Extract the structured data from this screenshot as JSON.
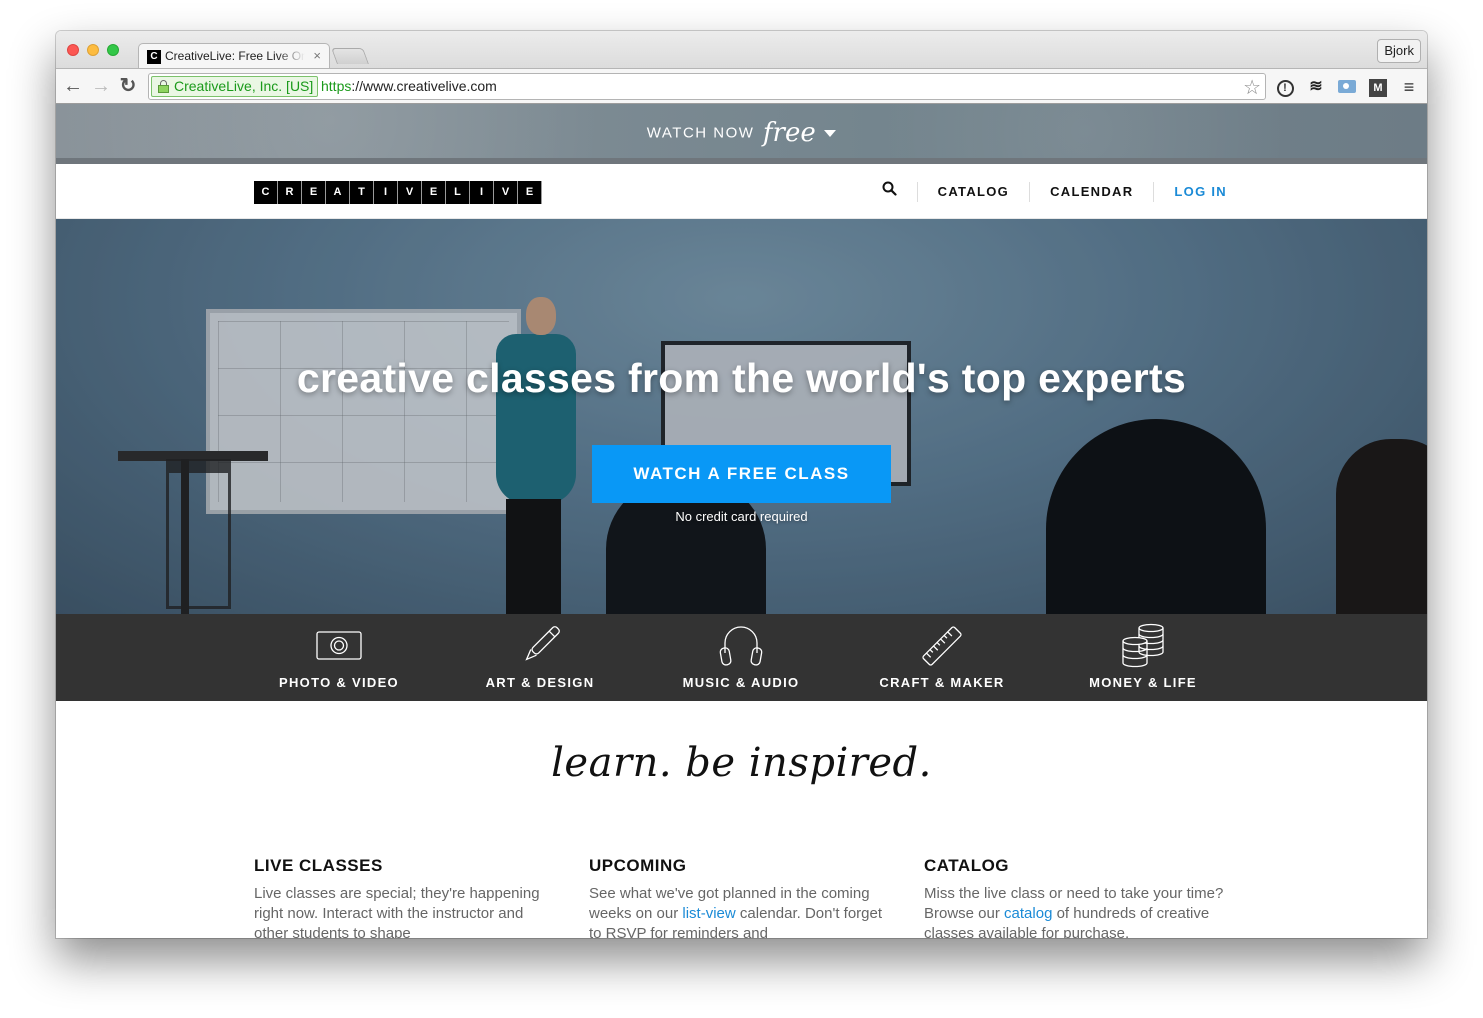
{
  "browser": {
    "tab_favicon": "C",
    "tab_title": "CreativeLive: Free Live Online",
    "tab_close": "×",
    "profile_name": "Bjork",
    "ev_label": "CreativeLive, Inc. [US]",
    "url_scheme": "https",
    "url_rest": "://www.creativelive.com",
    "nav": {
      "back": "←",
      "forward": "→",
      "reload": "↻"
    },
    "icons": {
      "star": "☆",
      "onepassword": "!",
      "buffer": "≋",
      "mega": "M",
      "menu": "≡"
    }
  },
  "promo": {
    "text": "WATCH NOW",
    "script": "free"
  },
  "header": {
    "logo_letters": [
      "C",
      "R",
      "E",
      "A",
      "T",
      "I",
      "V",
      "E",
      "L",
      "I",
      "V",
      "E"
    ],
    "search_icon": "⚲",
    "nav": [
      {
        "label": "CATALOG"
      },
      {
        "label": "CALENDAR"
      },
      {
        "label": "LOG IN"
      }
    ]
  },
  "hero": {
    "title": "creative classes from the world's top experts",
    "cta": "WATCH A FREE CLASS",
    "subtext": "No credit card required"
  },
  "categories": [
    {
      "label": "PHOTO & VIDEO",
      "icon": "camera-icon"
    },
    {
      "label": "ART & DESIGN",
      "icon": "pen-icon"
    },
    {
      "label": "MUSIC & AUDIO",
      "icon": "headphones-icon"
    },
    {
      "label": "CRAFT & MAKER",
      "icon": "ruler-icon"
    },
    {
      "label": "MONEY & LIFE",
      "icon": "coins-icon"
    }
  ],
  "tagline": "learn. be inspired.",
  "columns": [
    {
      "title": "LIVE CLASSES",
      "body_before": "Live classes are special; they're happening right now. Interact with the instructor and other students to shape",
      "link": "",
      "body_after": ""
    },
    {
      "title": "UPCOMING",
      "body_before": "See what we've got planned in the coming weeks on our ",
      "link": "list-view",
      "body_after": " calendar. Don't forget to RSVP for reminders and"
    },
    {
      "title": "CATALOG",
      "body_before": "Miss the live class or need to take your time? Browse our ",
      "link": "catalog",
      "body_after": " of hundreds of creative classes available for purchase."
    }
  ],
  "colors": {
    "accent_blue": "#0998f6",
    "link_blue": "#1a8ad6",
    "category_bar": "#333333",
    "ev_green": "#1a9a1a"
  }
}
